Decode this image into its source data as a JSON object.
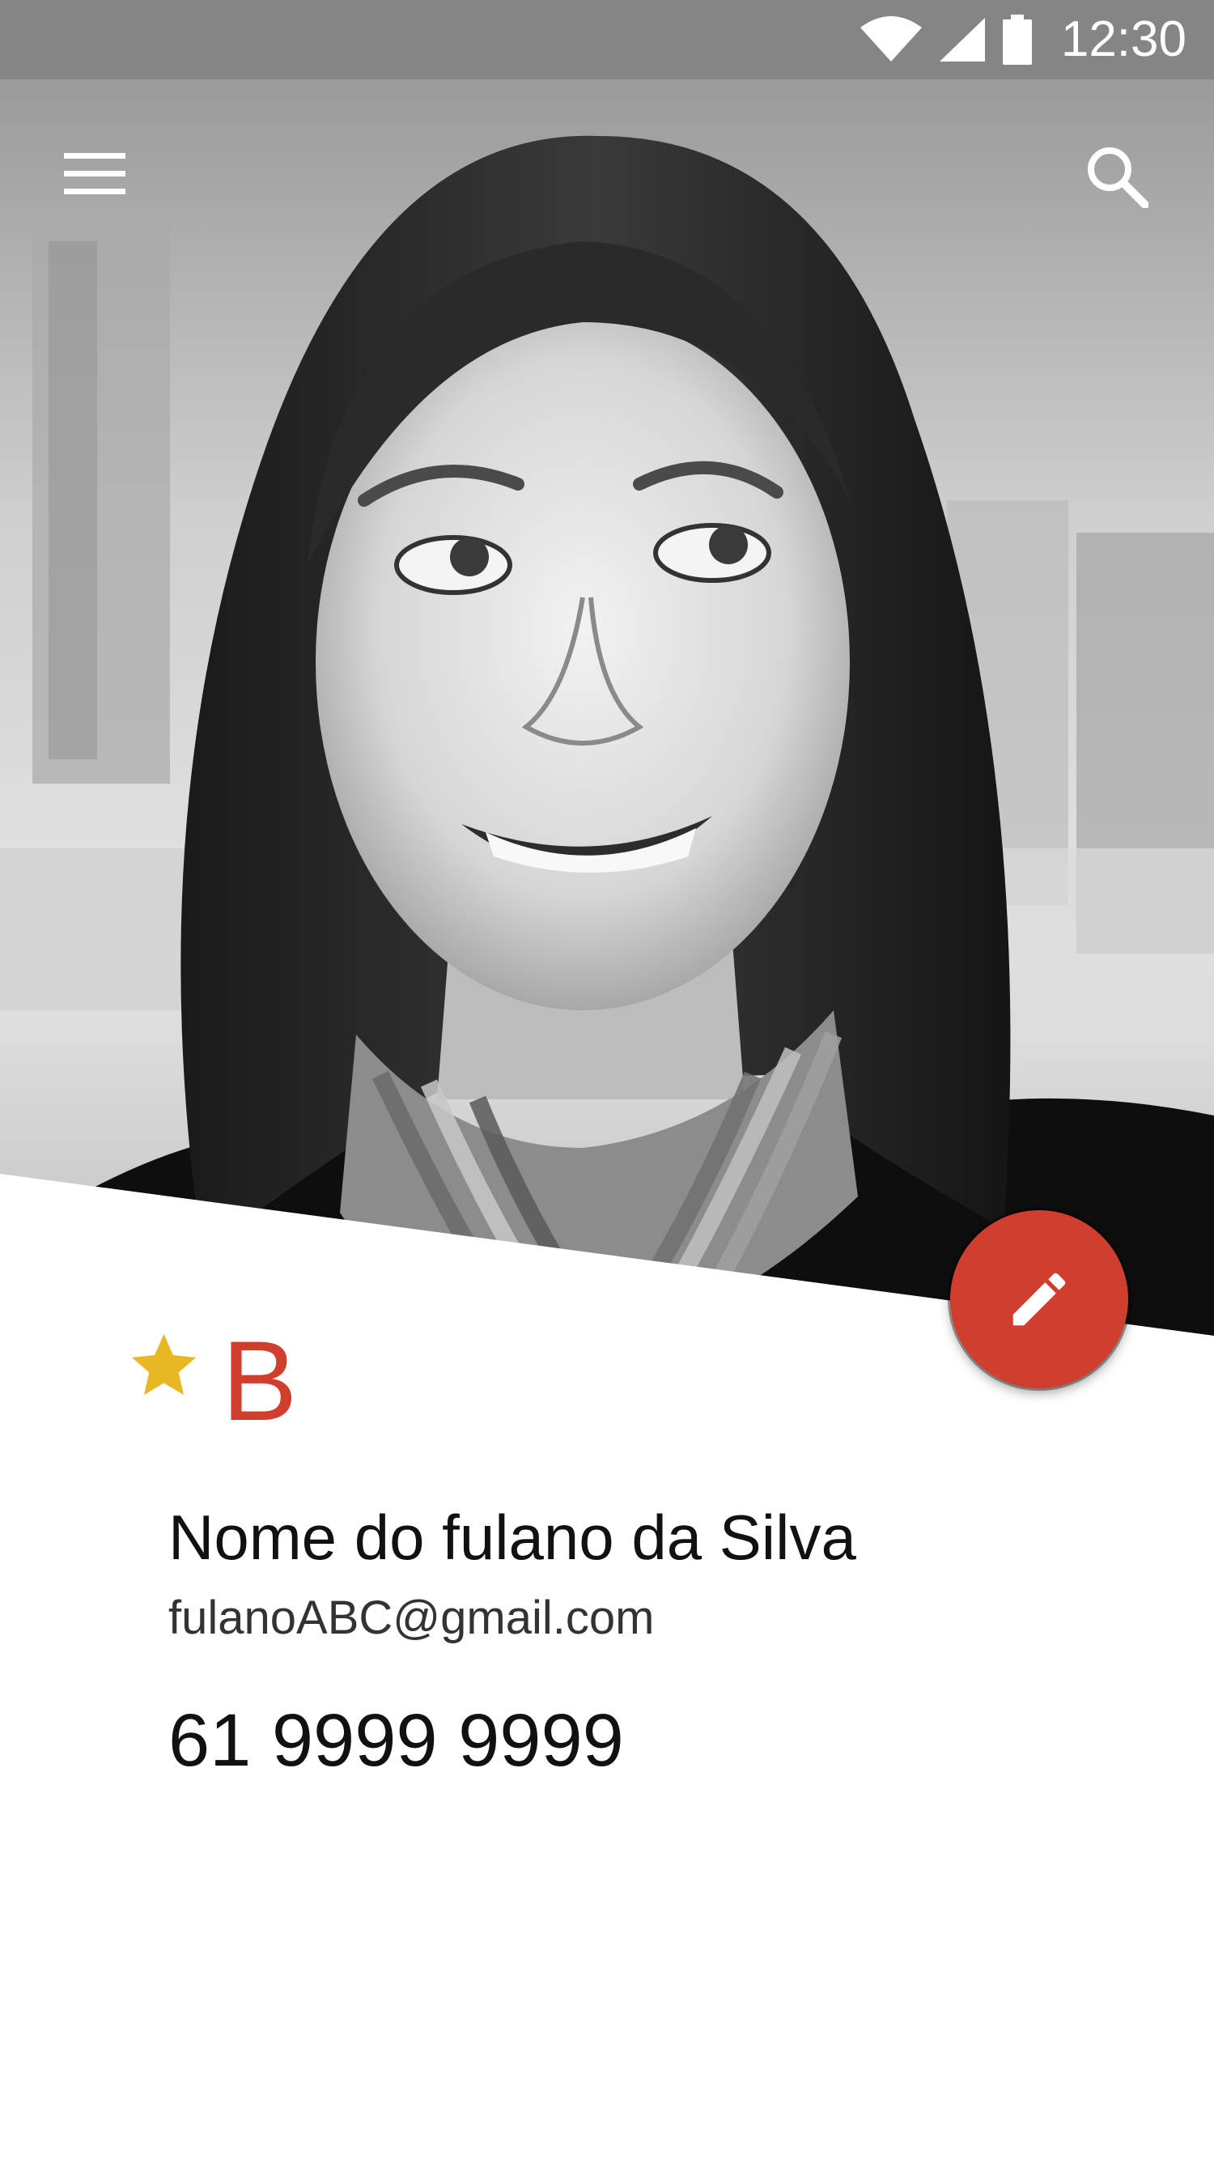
{
  "status_bar": {
    "time": "12:30",
    "icons": [
      "wifi-icon",
      "cellular-signal-icon",
      "battery-icon"
    ],
    "background_color": "#858585"
  },
  "toolbar": {
    "menu_icon": "hamburger-menu-icon",
    "search_icon": "search-icon"
  },
  "hero": {
    "image": "contact-photo (black and white portrait of a smiling woman with long hair and a striped scarf)"
  },
  "fab": {
    "icon": "pencil-edit-icon",
    "color": "#d03e2e"
  },
  "contact": {
    "favorite_icon": "star-icon",
    "star_color": "#e8b824",
    "group_letter": "B",
    "accent_color": "#d03e2e",
    "name": "Nome do fulano da Silva",
    "email": "fulanoABC@gmail.com",
    "phone": "61 9999 9999"
  }
}
